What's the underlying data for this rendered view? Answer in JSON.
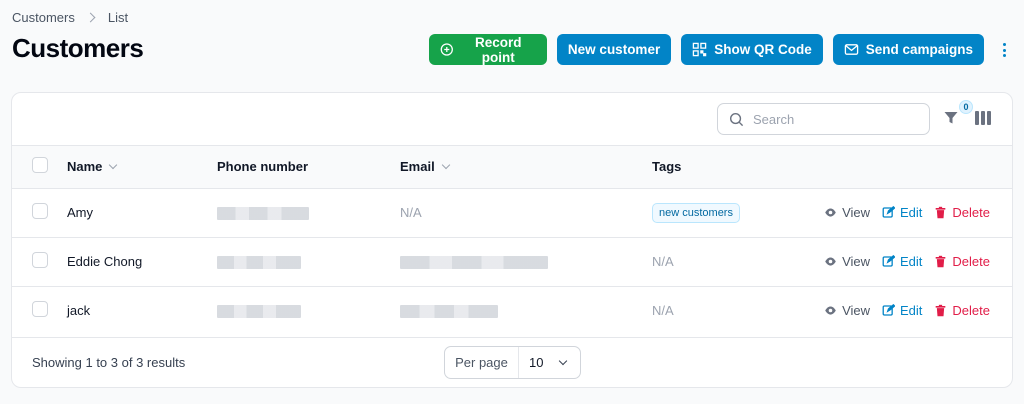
{
  "breadcrumb": {
    "items": [
      "Customers",
      "List"
    ]
  },
  "page": {
    "title": "Customers"
  },
  "actions": {
    "record_point": "Record point",
    "new_customer": "New customer",
    "show_qr": "Show QR Code",
    "send_campaigns": "Send campaigns"
  },
  "toolbar": {
    "search_placeholder": "Search",
    "filter_count": "0"
  },
  "table": {
    "headers": {
      "name": "Name",
      "phone": "Phone number",
      "email": "Email",
      "tags": "Tags"
    },
    "rows": [
      {
        "name": "Amy",
        "email": "N/A",
        "tag": "new customers",
        "tags_text": ""
      },
      {
        "name": "Eddie Chong",
        "email": "",
        "tag": "",
        "tags_text": "N/A"
      },
      {
        "name": "jack",
        "email": "",
        "tag": "",
        "tags_text": "N/A"
      }
    ],
    "row_actions": {
      "view": "View",
      "edit": "Edit",
      "delete": "Delete"
    }
  },
  "footer": {
    "results": "Showing 1 to 3 of 3 results",
    "per_page_label": "Per page",
    "per_page_value": "10"
  },
  "colors": {
    "green": "#16a34a",
    "blue": "#0284c7",
    "danger": "#e11d48"
  }
}
